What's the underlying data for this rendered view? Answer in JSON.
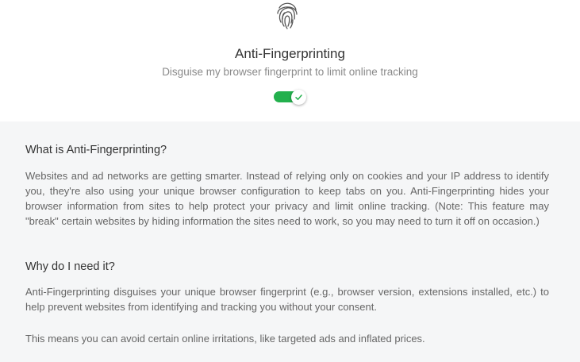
{
  "header": {
    "icon": "fingerprint-icon",
    "title": "Anti-Fingerprinting",
    "subtitle": "Disguise my browser fingerprint to limit online tracking",
    "toggle_on": true,
    "toggle_color": "#23b04d"
  },
  "info": {
    "what_heading": "What is Anti-Fingerprinting?",
    "what_body": "Websites and ad networks are getting smarter. Instead of relying only on cookies and your IP address to identify you, they're also using your unique browser configuration to keep tabs on you. Anti-Fingerprinting hides your browser information from sites to help protect your privacy and limit online tracking. (Note: This feature may \"break\" certain websites by hiding information the sites need to work, so you may need to turn it off on occasion.)",
    "why_heading": "Why do I need it?",
    "why_body": "Anti-Fingerprinting disguises your unique browser fingerprint (e.g., browser version, extensions installed, etc.) to help prevent websites from identifying and tracking you without your consent.",
    "why_body_2": "This means you can avoid certain online irritations, like targeted ads and inflated prices."
  }
}
